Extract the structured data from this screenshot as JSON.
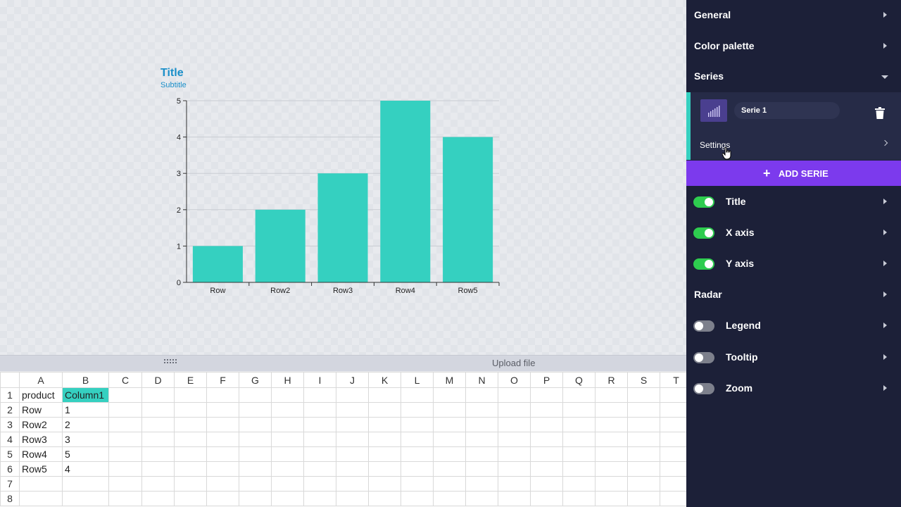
{
  "chart_data": {
    "type": "bar",
    "title": "Title",
    "subtitle": "Subtitle",
    "categories": [
      "Row",
      "Row2",
      "Row3",
      "Row4",
      "Row5"
    ],
    "values": [
      1,
      2,
      3,
      5,
      4
    ],
    "y_ticks": [
      0,
      1,
      2,
      3,
      4,
      5
    ],
    "ylim": [
      0,
      5
    ],
    "bar_color": "#35d0c0",
    "grid": true,
    "legend": false
  },
  "toolbar": {
    "upload_label": "Upload file"
  },
  "sheet": {
    "columns": [
      "A",
      "B",
      "C",
      "D",
      "E",
      "F",
      "G",
      "H",
      "I",
      "J",
      "K",
      "L",
      "M",
      "N",
      "O",
      "P",
      "Q",
      "R",
      "S",
      "T"
    ],
    "rows": [
      {
        "num": "1",
        "a": "product",
        "b": "Column1"
      },
      {
        "num": "2",
        "a": "Row",
        "b": "1"
      },
      {
        "num": "3",
        "a": "Row2",
        "b": "2"
      },
      {
        "num": "4",
        "a": "Row3",
        "b": "3"
      },
      {
        "num": "5",
        "a": "Row4",
        "b": "5"
      },
      {
        "num": "6",
        "a": "Row5",
        "b": "4"
      },
      {
        "num": "7",
        "a": "",
        "b": ""
      },
      {
        "num": "8",
        "a": "",
        "b": ""
      }
    ],
    "highlight_color": "#35d0c0"
  },
  "sidebar": {
    "general": "General",
    "color_palette": "Color palette",
    "series": "Series",
    "serie": {
      "name": "Serie 1",
      "settings": "Settings"
    },
    "add_serie": "ADD SERIE",
    "title": {
      "label": "Title",
      "enabled": true
    },
    "x_axis": {
      "label": "X axis",
      "enabled": true
    },
    "y_axis": {
      "label": "Y axis",
      "enabled": true
    },
    "radar": "Radar",
    "legend": {
      "label": "Legend",
      "enabled": false
    },
    "tooltip": {
      "label": "Tooltip",
      "enabled": false
    },
    "zoom": {
      "label": "Zoom",
      "enabled": false
    },
    "accent_color": "#7c3aed",
    "toggle_on_color": "#2ecc4f"
  }
}
